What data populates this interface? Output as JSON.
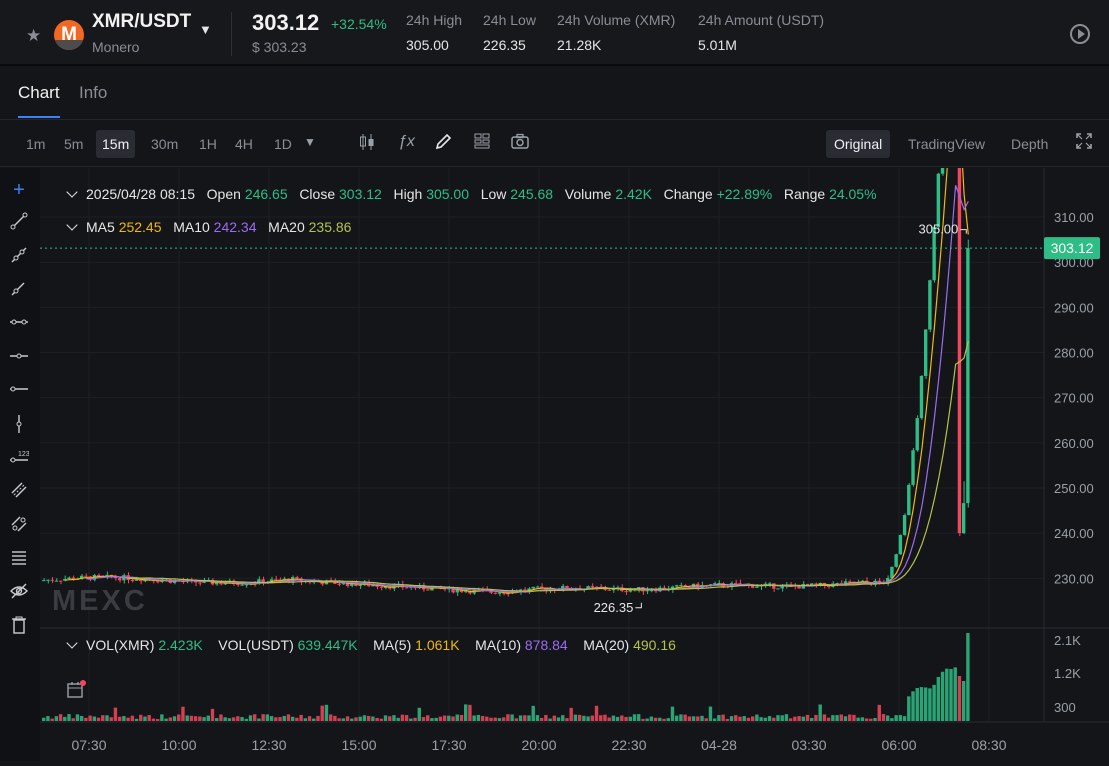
{
  "header": {
    "pair": "XMR/USDT",
    "coin_name": "Monero",
    "logo_letter": "M",
    "price": "303.12",
    "change_pct": "+32.54%",
    "usd_price": "$ 303.23",
    "stats": [
      {
        "label": "24h High",
        "value": "305.00"
      },
      {
        "label": "24h Low",
        "value": "226.35"
      },
      {
        "label": "24h Volume (XMR)",
        "value": "21.28K"
      },
      {
        "label": "24h Amount (USDT)",
        "value": "5.01M"
      }
    ]
  },
  "tabs": [
    {
      "label": "Chart"
    },
    {
      "label": "Info"
    }
  ],
  "toolbar": {
    "timeframes": [
      "1m",
      "5m",
      "15m",
      "30m",
      "1H",
      "4H",
      "1D"
    ],
    "selected_timeframe": "15m",
    "views": [
      "Original",
      "TradingView",
      "Depth"
    ],
    "selected_view": "Original"
  },
  "ohlc": {
    "date": "2025/04/28 08:15",
    "open_label": "Open",
    "open": "246.65",
    "close_label": "Close",
    "close": "303.12",
    "high_label": "High",
    "high": "305.00",
    "low_label": "Low",
    "low": "245.68",
    "volume_label": "Volume",
    "volume": "2.42K",
    "change_label": "Change",
    "change": "+22.89%",
    "range_label": "Range",
    "range": "24.05%"
  },
  "ma": {
    "ma5_label": "MA5",
    "ma5": "252.45",
    "ma10_label": "MA10",
    "ma10": "242.34",
    "ma20_label": "MA20",
    "ma20": "235.86"
  },
  "vol": {
    "xmr_label": "VOL(XMR)",
    "xmr": "2.423K",
    "usdt_label": "VOL(USDT)",
    "usdt": "639.447K",
    "ma5_label": "MA(5)",
    "ma5": "1.061K",
    "ma10_label": "MA(10)",
    "ma10": "878.84",
    "ma20_label": "MA(20)",
    "ma20": "490.16"
  },
  "watermark": "MEXC",
  "colors": {
    "up": "#2ebd85",
    "down": "#f6465d",
    "ma5": "#f0b90b",
    "ma10": "#9b6cf0",
    "ma20": "#b5c24a",
    "accent": "#3b82f6"
  },
  "chart_data": {
    "type": "candlestick",
    "price_axis": {
      "ticks": [
        "310.00",
        "300.00",
        "290.00",
        "280.00",
        "270.00",
        "260.00",
        "250.00",
        "240.00",
        "230.00"
      ],
      "ylim": [
        219.0,
        312.0
      ]
    },
    "volume_axis": {
      "ticks": [
        "2.1K",
        "1.2K",
        "300"
      ]
    },
    "time_axis": {
      "ticks": [
        "07:30",
        "10:00",
        "12:30",
        "15:00",
        "17:30",
        "20:00",
        "22:30",
        "04-28",
        "03:30",
        "06:00",
        "08:30"
      ]
    },
    "last_price": "303.12",
    "high_marker": "305.00",
    "low_marker": "226.35",
    "high": 305.0,
    "low": 226.35,
    "last_candle": {
      "open": 246.65,
      "close": 303.12,
      "high": 305.0,
      "low": 245.68
    }
  }
}
